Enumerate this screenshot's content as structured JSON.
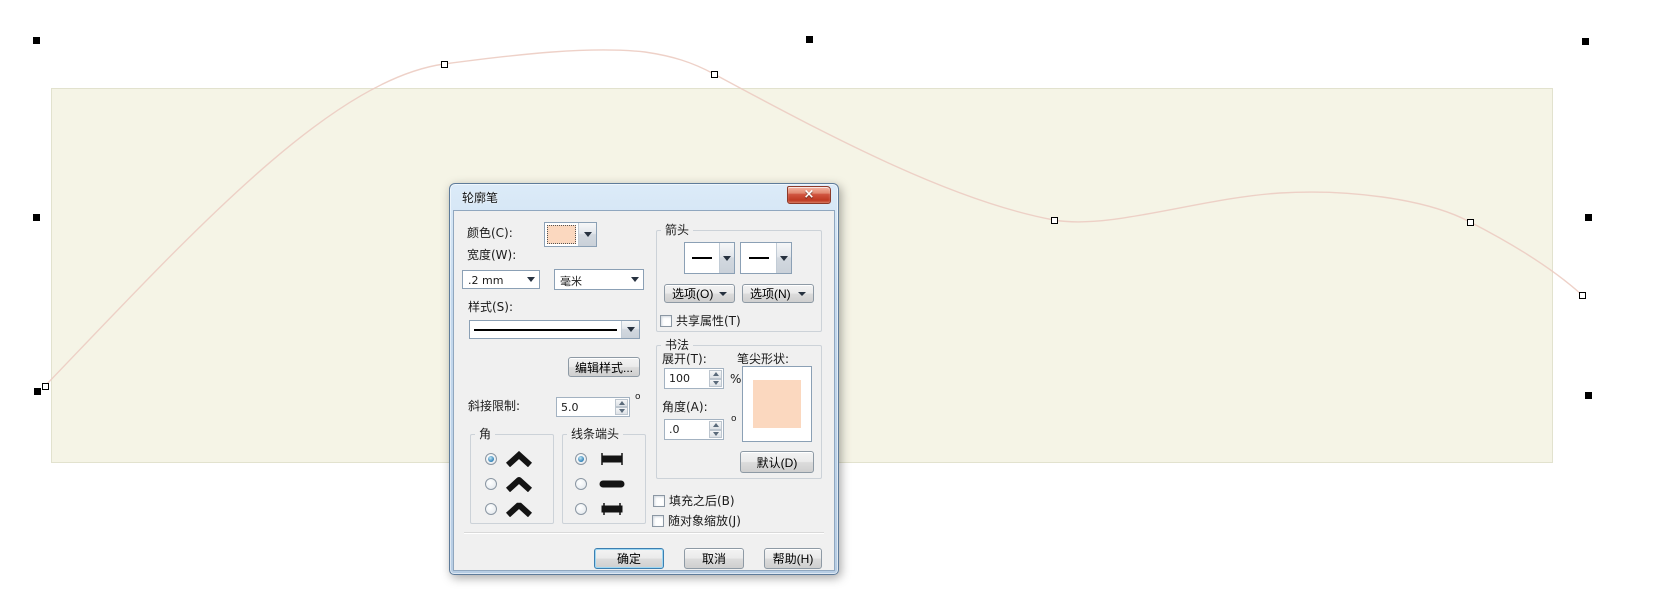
{
  "dialog": {
    "title": "轮廓笔",
    "close_glyph": "×",
    "left": {
      "color_label": "颜色(C):",
      "width_label": "宽度(W):",
      "width_value": ".2 mm",
      "unit_value": "毫米",
      "style_label": "样式(S):",
      "edit_style_button": "编辑样式...",
      "miter_label": "斜接限制:",
      "miter_value": "5.0",
      "miter_unit": "o"
    },
    "corner_group": {
      "label": "角",
      "options": [
        "miter-corner",
        "round-corner",
        "bevel-corner"
      ],
      "selected_index": 0
    },
    "cap_group": {
      "label": "线条端头",
      "options": [
        "butt-cap",
        "round-cap",
        "square-cap"
      ],
      "selected_index": 0
    },
    "arrows": {
      "group_label": "箭头",
      "options_left": "选项(O)",
      "options_right": "选项(N)",
      "share_attributes": "共享属性(T)",
      "share_checked": false
    },
    "calligraphy": {
      "group_label": "书法",
      "stretch_label": "展开(T):",
      "stretch_value": "100",
      "stretch_unit": "%",
      "nib_shape_label": "笔尖形状:",
      "angle_label": "角度(A):",
      "angle_value": ".0",
      "angle_unit": "o",
      "default_button": "默认(D)"
    },
    "checks": {
      "behind_fill": "填充之后(B)",
      "behind_fill_checked": false,
      "scale_with_object": "随对象缩放(J)",
      "scale_with_object_checked": false
    },
    "footer": {
      "ok": "确定",
      "cancel": "取消",
      "help": "帮助(H)"
    }
  },
  "colors": {
    "outline_swatch": "#fbd8bf",
    "nib_preview": "#fbd8bf",
    "curve_stroke": "#ecccc2",
    "artboard_fill": "#f5f4e6",
    "titlebar_top": "#dcebf8",
    "close_button_red": "#d05540",
    "dialog_face": "#f0f0f0"
  }
}
